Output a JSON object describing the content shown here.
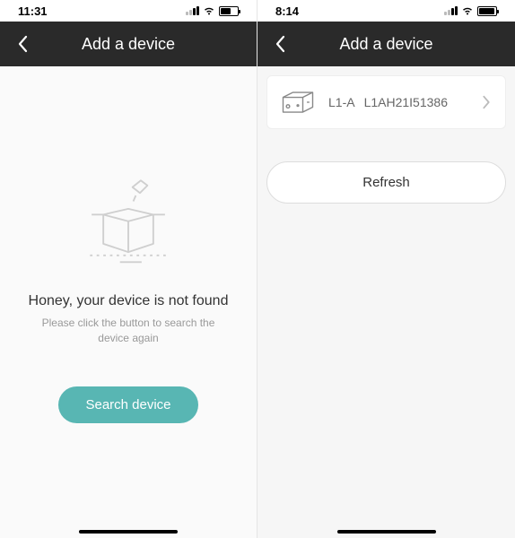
{
  "left": {
    "status": {
      "time": "11:31"
    },
    "header": {
      "title": "Add a device"
    },
    "empty": {
      "title": "Honey, your device is not found",
      "subtitle": "Please click the button to search the device again"
    },
    "search_button": "Search device"
  },
  "right": {
    "status": {
      "time": "8:14"
    },
    "header": {
      "title": "Add a device"
    },
    "device": {
      "model": "L1-A",
      "serial": "L1AH21I51386"
    },
    "refresh_button": "Refresh"
  }
}
